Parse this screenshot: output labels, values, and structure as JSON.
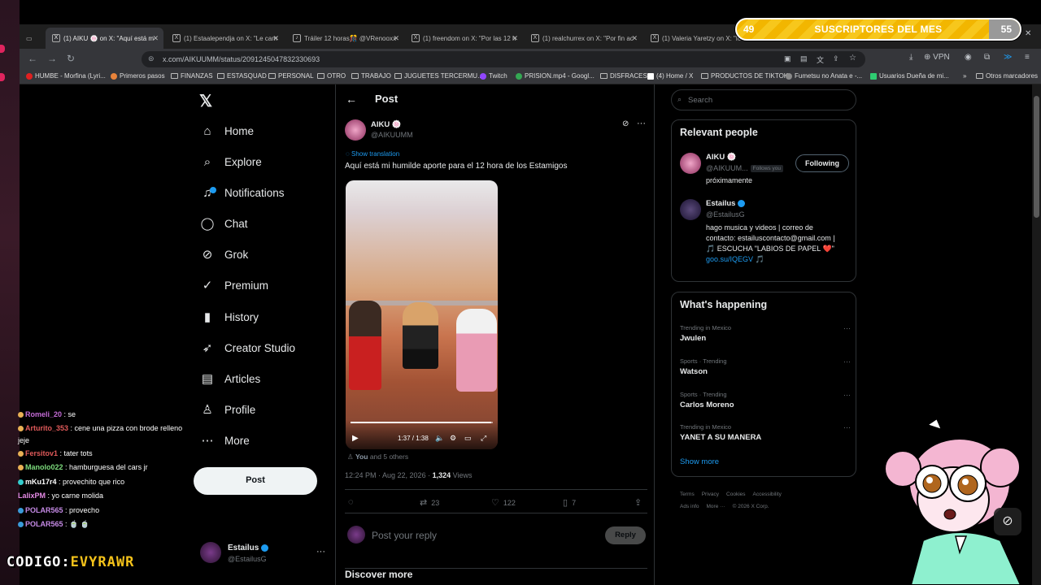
{
  "browser": {
    "tabs": [
      {
        "label": "(1) AIKU 🍥 on X: \"Aquí está m"
      },
      {
        "label": "(1) Estaalependja on X: \"Le cam"
      },
      {
        "label": "Tráiler 12 horas🎊 @VRenooxx"
      },
      {
        "label": "(1) freendom on X: \"Por las 12 h"
      },
      {
        "label": "(1) realchurrex on X: \"Por fin ac"
      },
      {
        "label": "(1) Valeria Yaretzy on X: \"lo v"
      }
    ],
    "url": "x.com/AIKUUMM/status/2091245047832330693",
    "vpn_label": "VPN",
    "bookmarks": [
      "HUMBE - Morfina (Lyri...",
      "Primeros pasos",
      "FINANZAS",
      "ESTASQUAD",
      "PERSONAL",
      "OTRO",
      "TRABAJO",
      "JUGUETES TERCERMU...",
      "Twitch",
      "PRISION.mp4 - Googl...",
      "DISFRACES",
      "(4) Home / X",
      "PRODUCTOS DE TIKTOK",
      "Fumetsu no Anata e -...",
      "Usuarios Dueña de mi...",
      "Otros marcadores"
    ]
  },
  "overlay": {
    "subs_current": "49",
    "subs_label": "SUSCRIPTORES DEL MES",
    "subs_goal": "55",
    "code_prefix": "CODIGO:",
    "code_value": "EVYRAWR",
    "chat": [
      {
        "user": "Romeli_20",
        "msg": ": se",
        "color": "#c46bd6"
      },
      {
        "user": "Arturito_353",
        "msg": ": cene una pizza con brode relleno jeje",
        "color": "#e05a5a"
      },
      {
        "user": "Fersitov1",
        "msg": ": tater tots",
        "color": "#e05a5a"
      },
      {
        "user": "Manolo022",
        "msg": ": hamburguesa del cars jr",
        "color": "#7ddc7d"
      },
      {
        "user": "mKu17r4",
        "msg": ": provechito que rico",
        "color": "#ffffff"
      },
      {
        "user": "LalixPM",
        "msg": ": yo carne molida",
        "color": "#e58ae5"
      },
      {
        "user": "POLAR565",
        "msg": ": provecho",
        "color": "#c58ae5"
      },
      {
        "user": "POLAR565",
        "msg": ": 🍵 🍵",
        "color": "#c58ae5"
      }
    ]
  },
  "x_nav": {
    "items": [
      {
        "label": "Home",
        "icon": "⌂"
      },
      {
        "label": "Explore",
        "icon": "⌕"
      },
      {
        "label": "Notifications",
        "icon": "🔔"
      },
      {
        "label": "Chat",
        "icon": "◯"
      },
      {
        "label": "Grok",
        "icon": "⊘"
      },
      {
        "label": "Premium",
        "icon": "✓"
      },
      {
        "label": "History",
        "icon": "▮"
      },
      {
        "label": "Creator Studio",
        "icon": "➶"
      },
      {
        "label": "Articles",
        "icon": "▤"
      },
      {
        "label": "Profile",
        "icon": "♙"
      },
      {
        "label": "More",
        "icon": "⋯"
      }
    ],
    "post_button": "Post",
    "account_name": "Estailus",
    "account_handle": "@EstailusG"
  },
  "post": {
    "header": "Post",
    "author_name": "AIKU 🍥",
    "author_handle": "@AIKUUMM",
    "translate": "Show translation",
    "text": "Aquí está mi humilde aporte para el 12 hora de los Estamigos",
    "video_time": "1:37 / 1:38",
    "video_progress": 0.99,
    "liked_by_you": "You",
    "liked_by_rest": "and 5 others",
    "timestamp": "12:24 PM · Aug 22, 2026 ·",
    "views_count": "1,324",
    "views_label": "Views",
    "replies": "",
    "reposts": "23",
    "likes": "122",
    "bookmarks": "7",
    "reply_placeholder": "Post your reply",
    "reply_button": "Reply",
    "discover": "Discover more"
  },
  "sidebar": {
    "search_placeholder": "Search",
    "relevant_title": "Relevant people",
    "people": [
      {
        "name": "AIKU 🍥",
        "handle": "@AIKUUM...",
        "follows_you": "Follows you",
        "button": "Following",
        "bio": "próximamente"
      },
      {
        "name": "Estailus",
        "handle": "@EstailusG",
        "bio": "hago musica y videos | correo de contacto: estailuscontacto@gmail.com | 🎵 ESCUCHA \"LABIOS DE PAPEL ❤️\"",
        "link": "goo.su/IQEGV 🎵"
      }
    ],
    "happening_title": "What's happening",
    "trends": [
      {
        "context": "Trending in Mexico",
        "name": "Jwulen"
      },
      {
        "context": "Sports · Trending",
        "name": "Watson"
      },
      {
        "context": "Sports · Trending",
        "name": "Carlos Moreno"
      },
      {
        "context": "Trending in Mexico",
        "name": "YANET A SU MANERA"
      }
    ],
    "show_more": "Show more",
    "footer": [
      "Terms",
      "Privacy",
      "Cookies",
      "Accessibility",
      "Ads info",
      "More ···",
      "© 2026 X Corp."
    ]
  },
  "colors": {
    "accent": "#1d9bf0",
    "bg": "#000000",
    "subs_bar": "#f2b600"
  }
}
